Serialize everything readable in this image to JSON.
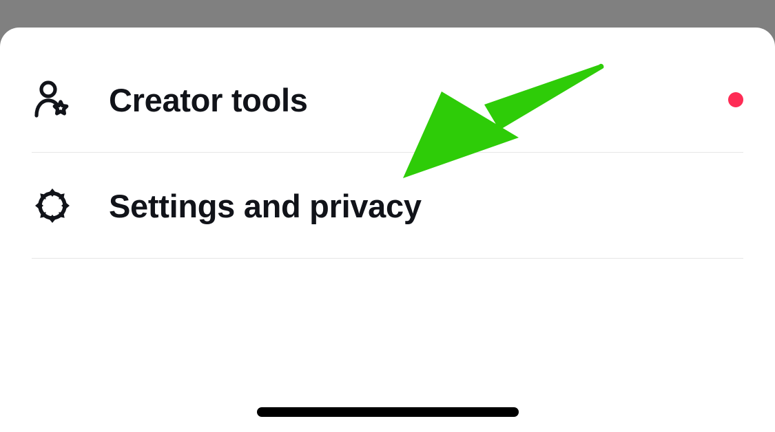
{
  "menu": {
    "items": [
      {
        "label": "Creator tools",
        "icon": "creator-tools-icon",
        "notification": true
      },
      {
        "label": "Settings and privacy",
        "icon": "gear-icon",
        "notification": false
      }
    ]
  },
  "annotation": {
    "arrow_color": "#2ECC08"
  },
  "colors": {
    "notification_dot": "#FE2C55",
    "text": "#111319"
  }
}
